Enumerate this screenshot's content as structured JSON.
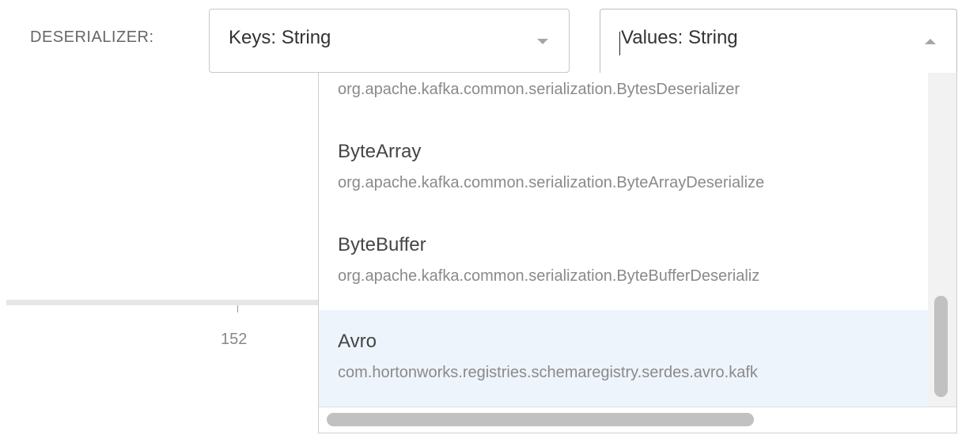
{
  "deserializer_label": "DESERIALIZER:",
  "keys_select": {
    "value": "Keys: String",
    "expanded": false
  },
  "values_select": {
    "value": "Values: String",
    "expanded": true
  },
  "background_axis": {
    "tick_label": "152"
  },
  "menu": {
    "options": [
      {
        "name": "",
        "class": "org.apache.kafka.common.serialization.BytesDeserializer",
        "highlighted": false
      },
      {
        "name": "ByteArray",
        "class": "org.apache.kafka.common.serialization.ByteArrayDeserialize",
        "highlighted": false
      },
      {
        "name": "ByteBuffer",
        "class": "org.apache.kafka.common.serialization.ByteBufferDeserializ",
        "highlighted": false
      },
      {
        "name": "Avro",
        "class": "com.hortonworks.registries.schemaregistry.serdes.avro.kafk",
        "highlighted": true
      }
    ]
  },
  "colors": {
    "highlight": "#edf4fc",
    "scrollbar_thumb": "#c1c1c1",
    "option_name": "#454545",
    "option_class": "#8a8a8a"
  },
  "icons": {
    "keys_select_arrow": "chevron-down-icon",
    "values_select_arrow": "chevron-up-icon"
  }
}
